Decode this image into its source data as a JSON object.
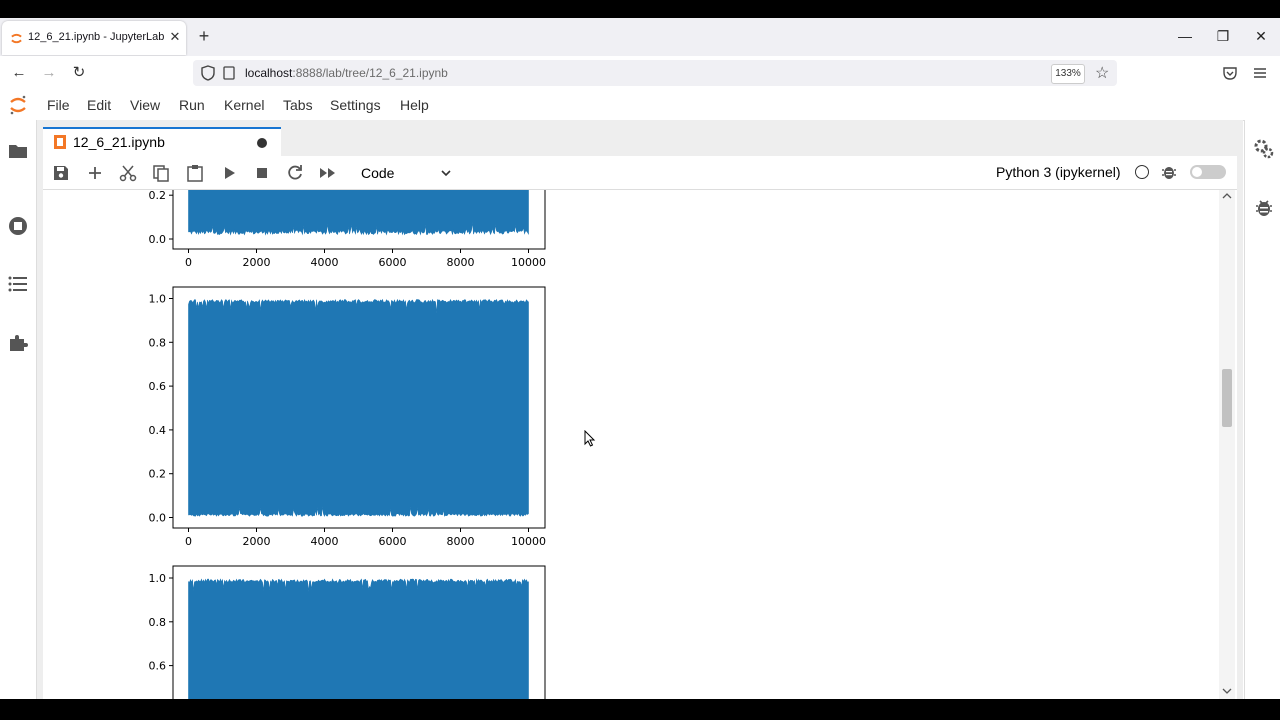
{
  "browser": {
    "tab_title": "12_6_21.ipynb - JupyterLab",
    "tab_close": "✕",
    "new_tab": "+",
    "url_host": "localhost",
    "url_path": ":8888/lab/tree/12_6_21.ipynb",
    "zoom": "133%",
    "window_controls": {
      "minimize": "—",
      "restore": "❐",
      "close": "✕"
    },
    "nav": {
      "back": "←",
      "forward": "→",
      "reload": "↻"
    }
  },
  "menubar": {
    "items": [
      "File",
      "Edit",
      "View",
      "Run",
      "Kernel",
      "Tabs",
      "Settings",
      "Help"
    ]
  },
  "notebook": {
    "tab_title": "12_6_21.ipynb",
    "cell_type": "Code",
    "kernel": "Python 3 (ipykernel)"
  },
  "icons": {
    "toolbar": [
      "save-icon",
      "add-cell-icon",
      "cut-icon",
      "copy-icon",
      "paste-icon",
      "run-icon",
      "stop-icon",
      "restart-icon",
      "fast-forward-icon"
    ],
    "left_sidebar": [
      "folder-icon",
      "running-icon",
      "table-of-contents-icon",
      "extension-icon"
    ],
    "right_sidebar": [
      "property-inspector-icon",
      "debugger-icon"
    ]
  },
  "colors": {
    "series": "#1f77b4",
    "accent": "#1976d2",
    "jupyter_orange": "#f37726"
  },
  "chart_data": [
    {
      "type": "line",
      "title": "",
      "xlabel": "",
      "ylabel": "",
      "x_ticks": [
        "0",
        "2000",
        "4000",
        "6000",
        "8000",
        "10000"
      ],
      "y_ticks": [
        "0.0",
        "0.2"
      ],
      "xlim": [
        0,
        10000
      ],
      "visible_ylim": [
        0,
        0.25
      ],
      "series": [
        {
          "values_summary": "dense noise over 10000 samples filling 0.0 to above 0.2, mostly 0.02 baseline"
        }
      ]
    },
    {
      "type": "line",
      "title": "",
      "xlabel": "",
      "ylabel": "",
      "x_ticks": [
        "0",
        "2000",
        "4000",
        "6000",
        "8000",
        "10000"
      ],
      "y_ticks": [
        "0.0",
        "0.2",
        "0.4",
        "0.6",
        "0.8",
        "1.0"
      ],
      "xlim": [
        0,
        10000
      ],
      "ylim": [
        -0.05,
        1.05
      ],
      "series": [
        {
          "values_summary": "dense uniform noise over 10000 samples spanning about 0.01 to 0.995"
        }
      ]
    },
    {
      "type": "line",
      "title": "",
      "xlabel": "",
      "ylabel": "",
      "x_ticks": [],
      "y_ticks": [
        "0.6",
        "0.8",
        "1.0"
      ],
      "xlim": [
        0,
        10000
      ],
      "visible_ylim": [
        0.55,
        1.05
      ],
      "series": [
        {
          "values_summary": "dense noise over 10000 samples reaching about 0.99 at top, cut off below 0.6"
        }
      ]
    }
  ]
}
